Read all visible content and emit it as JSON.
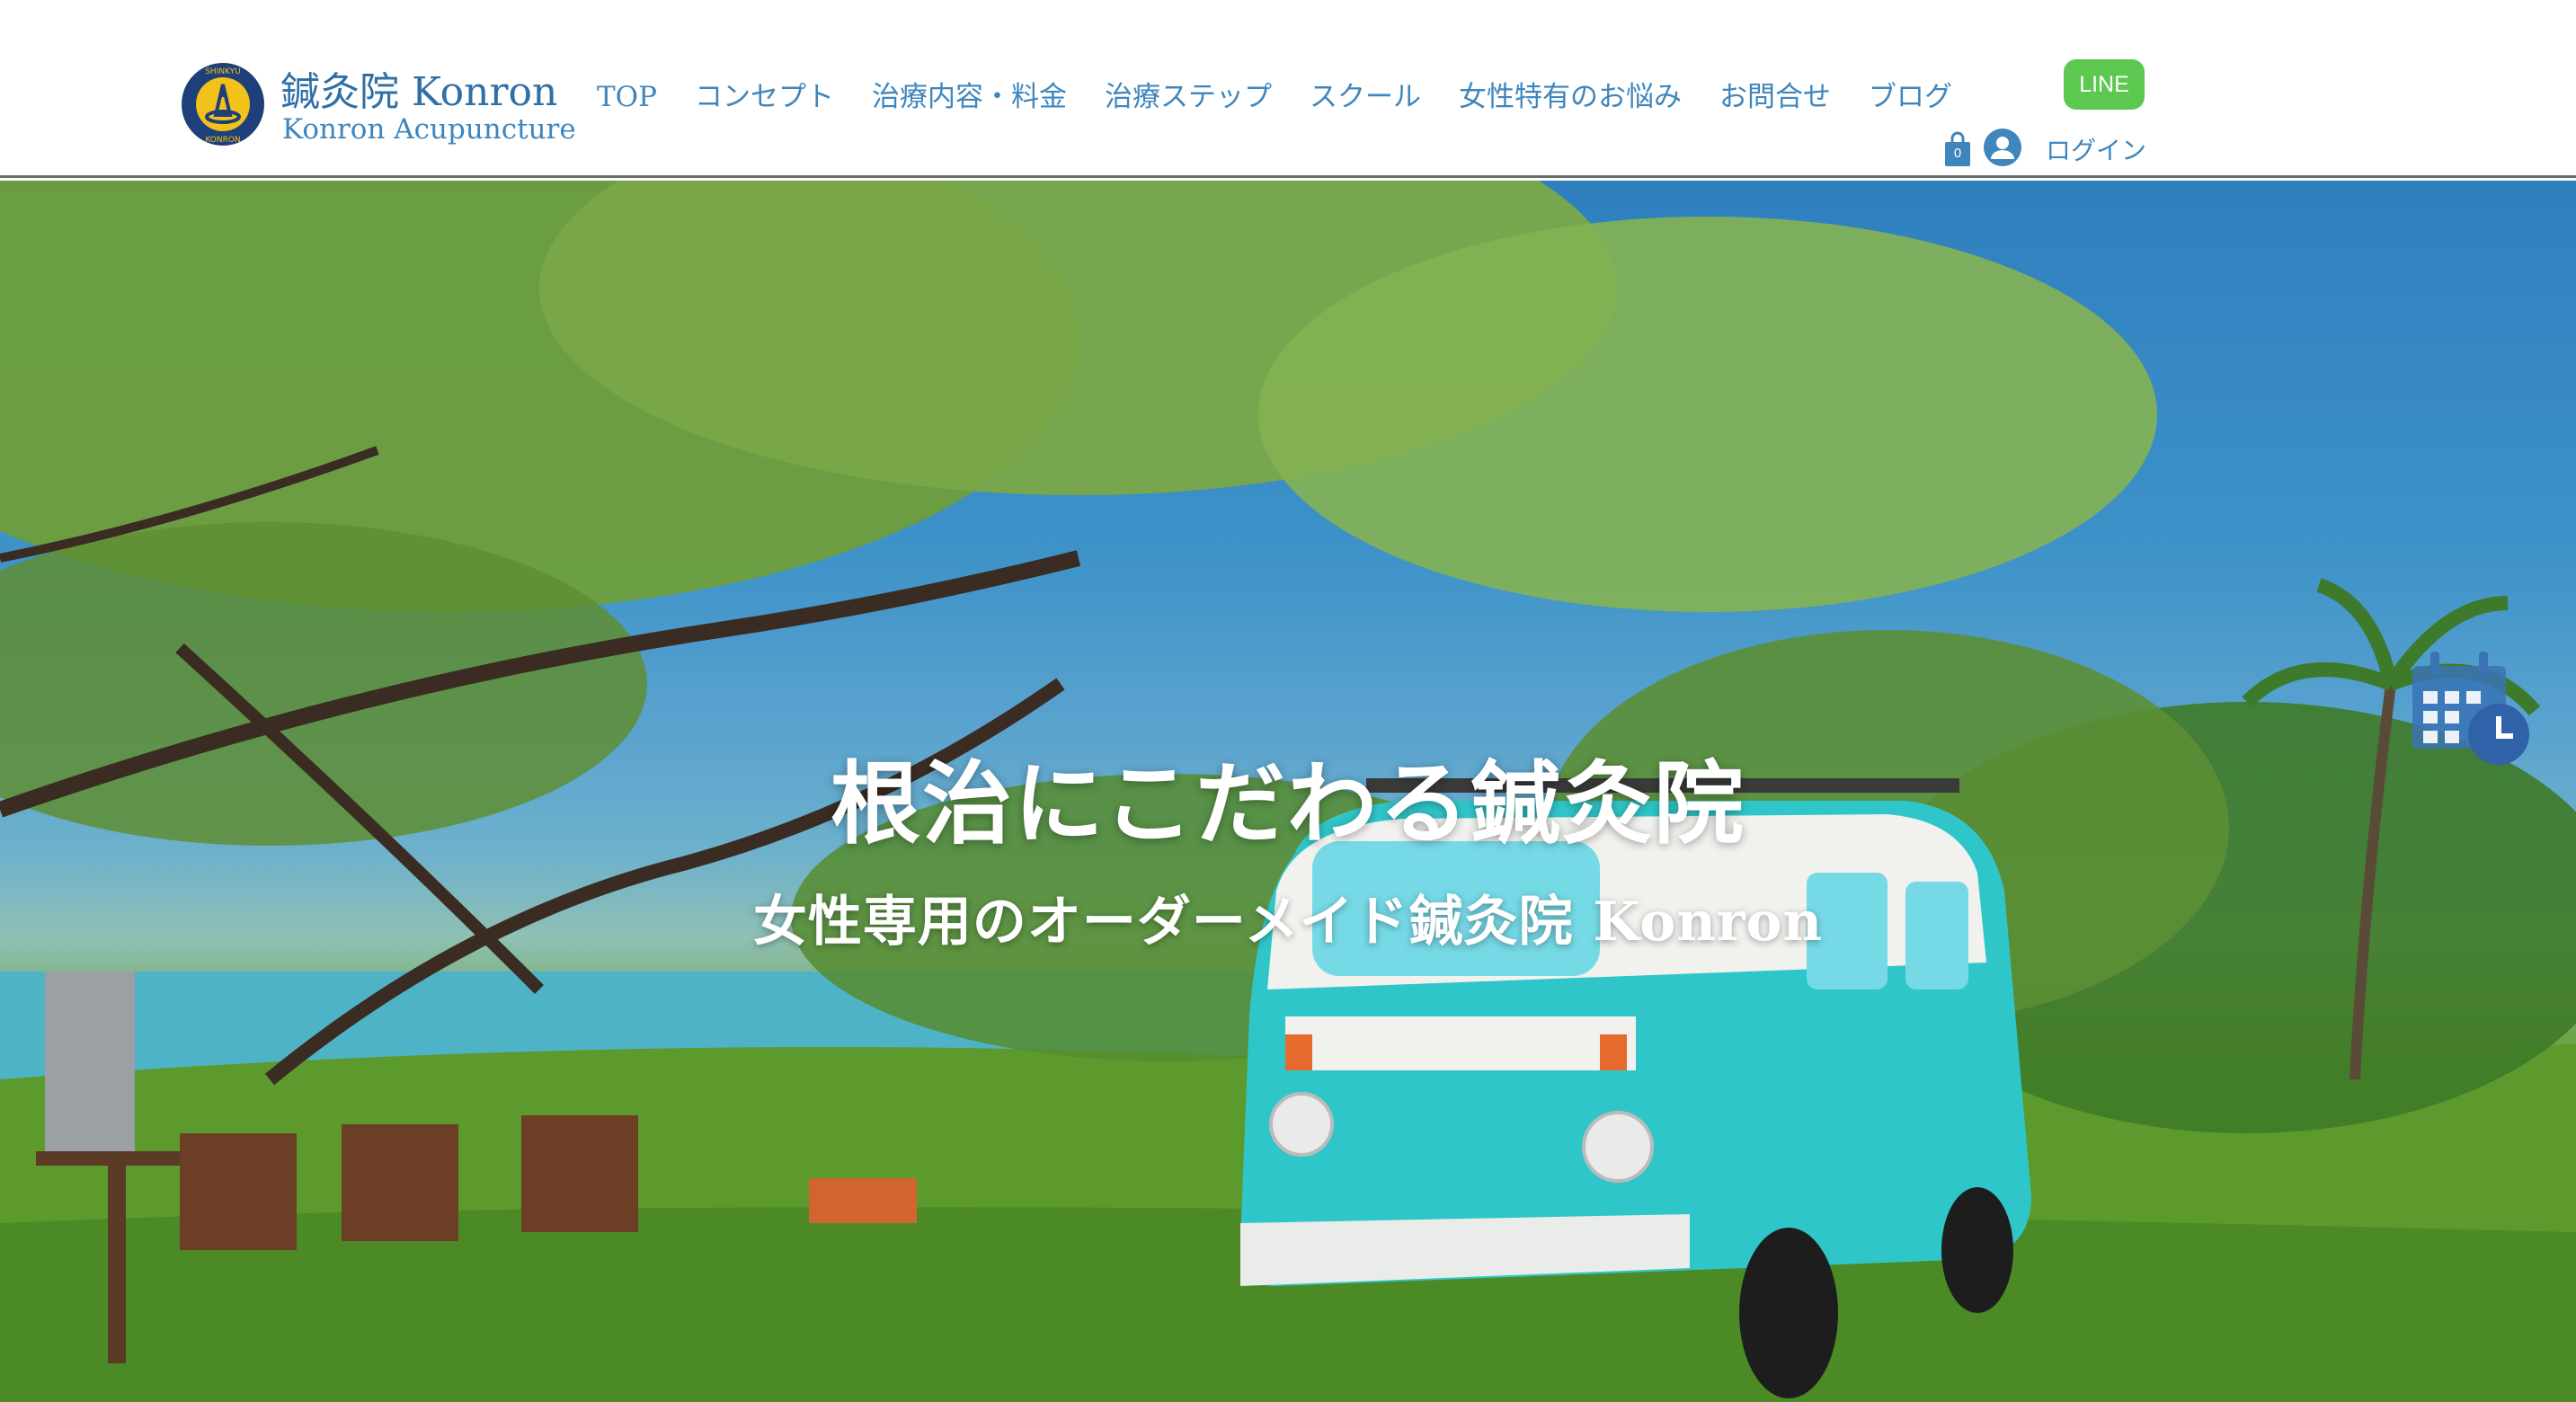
{
  "header": {
    "brand_title": "鍼灸院 Konron",
    "brand_subtitle": "Konron Acupuncture",
    "logo_ring_top": "SHINKYU",
    "logo_ring_bottom": "KONRON",
    "nav": [
      {
        "label": "TOP"
      },
      {
        "label": "コンセプト"
      },
      {
        "label": "治療内容・料金"
      },
      {
        "label": "治療ステップ"
      },
      {
        "label": "スクール"
      },
      {
        "label": "女性特有のお悩み"
      },
      {
        "label": "お問合せ"
      },
      {
        "label": "ブログ"
      }
    ],
    "line_button": "LINE",
    "cart_count": "0",
    "login": "ログイン"
  },
  "hero": {
    "title": "根治にこだわる鍼灸院",
    "subtitle": "女性専用のオーダーメイド鍼灸院 Konron"
  },
  "icons": {
    "logo": "konron-logo-icon",
    "cart": "shopping-bag-icon",
    "avatar": "user-avatar-icon",
    "calendar": "calendar-clock-icon"
  },
  "colors": {
    "brand_blue": "#3f86bd",
    "line_green": "#5cc84f",
    "van_teal": "#2fc6c9",
    "header_bg": "#ffffff"
  }
}
